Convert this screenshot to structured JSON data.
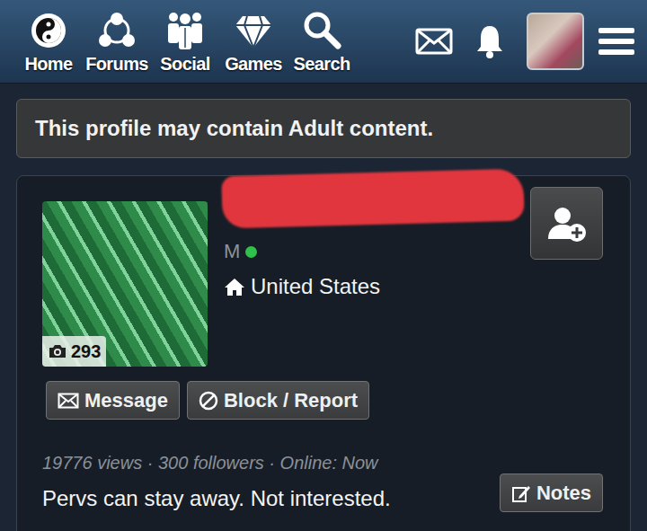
{
  "nav": {
    "items": [
      {
        "label": "Home"
      },
      {
        "label": "Forums"
      },
      {
        "label": "Social"
      },
      {
        "label": "Games"
      },
      {
        "label": "Search"
      }
    ]
  },
  "banner": {
    "text": "This profile may contain Adult content."
  },
  "profile": {
    "photo_count": "293",
    "gender": "M",
    "online": true,
    "location": "United States",
    "buttons": [
      "Message",
      "Block / Report"
    ],
    "stats": "19776 views · 300 followers · Online: Now",
    "status": "Pervs can stay away. Not interested.",
    "notes_button": "Notes"
  }
}
